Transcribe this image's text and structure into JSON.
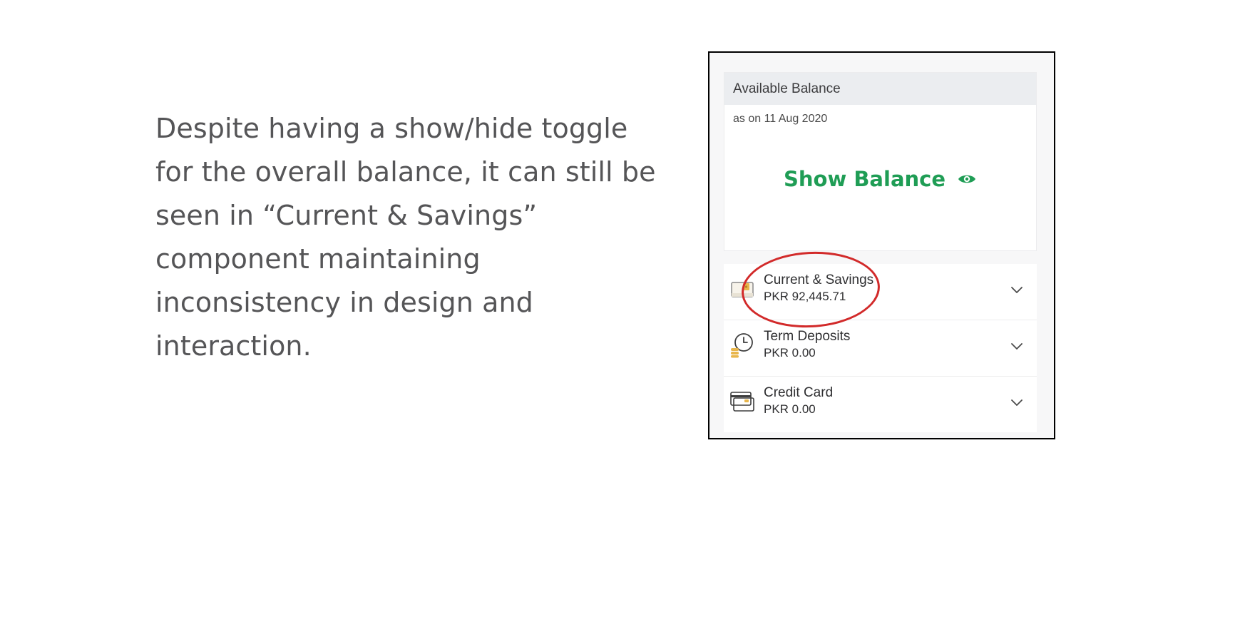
{
  "note": {
    "lines": [
      "Despite having a show/hide toggle",
      "for the overall balance, it can still be",
      "seen in “Current & Savings”",
      "component maintaining",
      "inconsistency in design and",
      "interaction."
    ]
  },
  "balance_card": {
    "title": "Available Balance",
    "date": "as on 11 Aug 2020",
    "show_label": "Show Balance",
    "show_icon": "eye-icon",
    "accent_color": "#1f9d55"
  },
  "accounts": [
    {
      "name": "Current & Savings",
      "amount": "PKR 92,445.71",
      "icon": "wallet-icon"
    },
    {
      "name": "Term Deposits",
      "amount": "PKR 0.00",
      "icon": "clock-coins-icon"
    },
    {
      "name": "Credit Card",
      "amount": "PKR 0.00",
      "icon": "credit-card-icon"
    }
  ],
  "annotation": {
    "color": "#d22a2a",
    "target": "Current & Savings"
  }
}
